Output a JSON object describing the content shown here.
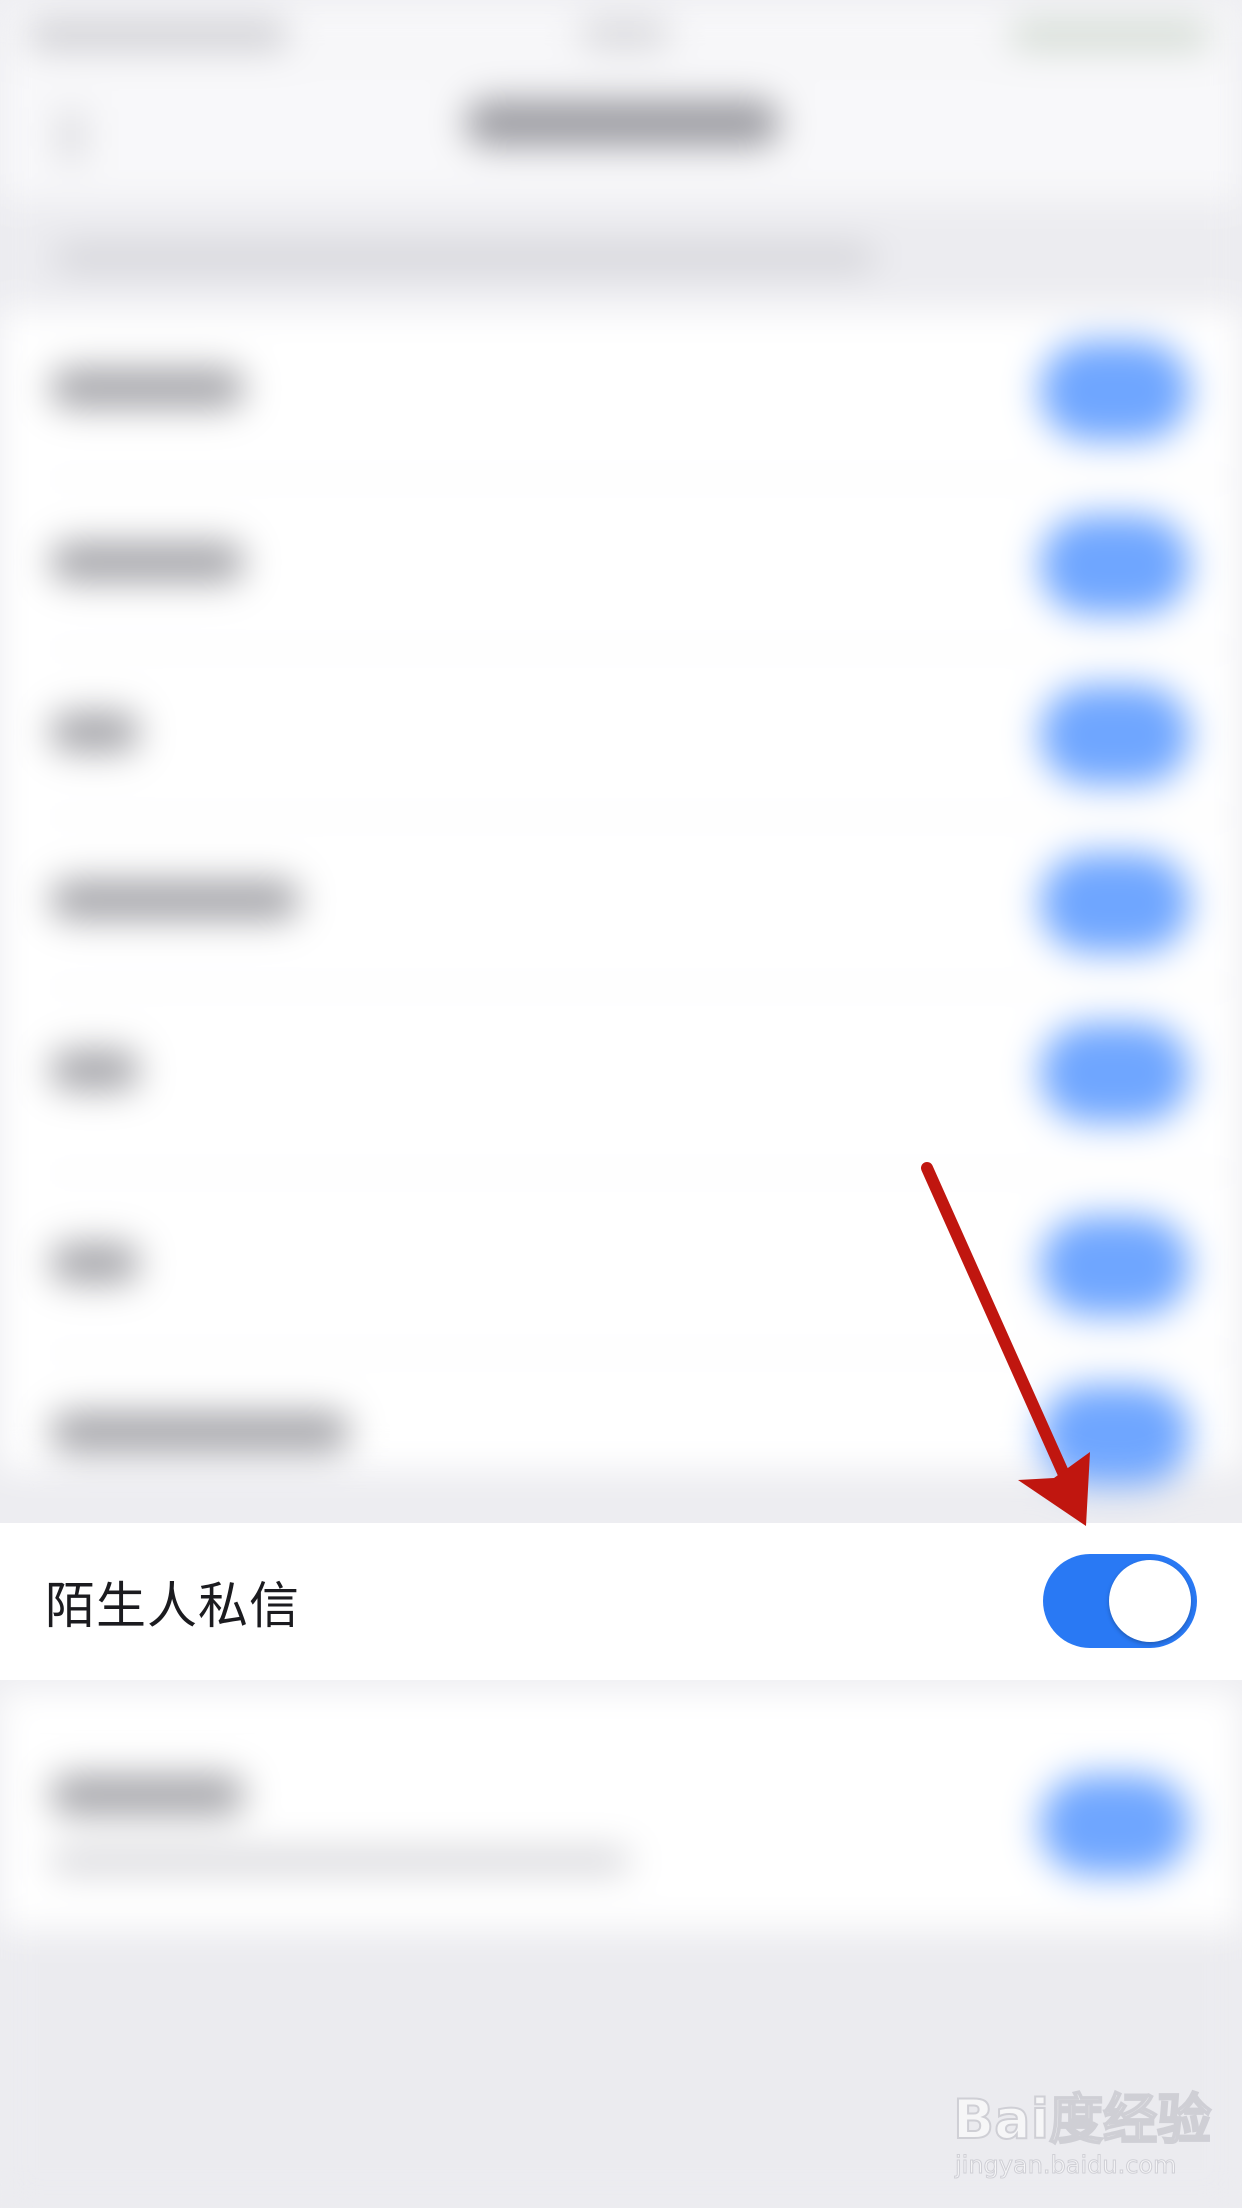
{
  "settings_row": {
    "label": "陌生人私信",
    "toggle_on": true,
    "toggle_color": "#2979f4"
  },
  "annotation": {
    "type": "arrow",
    "color": "#c0160f",
    "points_to": "stranger-message-toggle"
  },
  "watermark": {
    "logo": "Bai度经验",
    "url": "jingyan.baidu.com"
  },
  "colors": {
    "background": "#ededf1",
    "row_background": "#ffffff",
    "text": "#1b1b1f",
    "blurred_toggle": "#6fa6ff"
  }
}
